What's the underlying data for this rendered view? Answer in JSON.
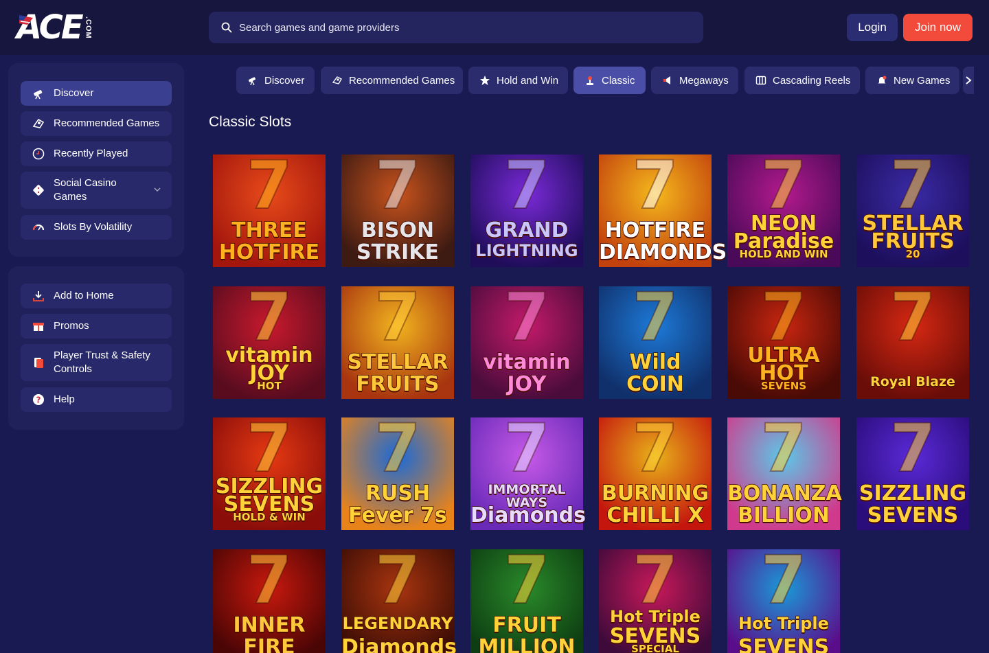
{
  "header": {
    "logo_text": "ACE",
    "logo_suffix": ".COM",
    "search_placeholder": "Search games and game providers",
    "login_label": "Login",
    "join_label": "Join now"
  },
  "sidebar": {
    "primary": [
      {
        "label": "Discover",
        "icon": "telescope-icon",
        "active": true
      },
      {
        "label": "Recommended Games",
        "icon": "recommended-icon"
      },
      {
        "label": "Recently Played",
        "icon": "clock-icon"
      },
      {
        "label": "Social Casino Games",
        "icon": "dice-icon",
        "expandable": true
      },
      {
        "label": "Slots By Volatility",
        "icon": "gauge-icon"
      }
    ],
    "secondary": [
      {
        "label": "Add to Home",
        "icon": "download-icon"
      },
      {
        "label": "Promos",
        "icon": "gift-icon"
      },
      {
        "label": "Player Trust & Safety Controls",
        "icon": "cards-icon"
      },
      {
        "label": "Help",
        "icon": "help-icon"
      }
    ]
  },
  "tabs": [
    {
      "label": "Discover",
      "icon": "telescope-icon"
    },
    {
      "label": "Recommended Games",
      "icon": "recommended-icon"
    },
    {
      "label": "Hold and Win",
      "icon": "star-icon"
    },
    {
      "label": "Classic",
      "icon": "joystick-icon",
      "active": true
    },
    {
      "label": "Megaways",
      "icon": "megaphone-icon"
    },
    {
      "label": "Cascading Reels",
      "icon": "reels-icon"
    },
    {
      "label": "New Games",
      "icon": "bell-icon"
    }
  ],
  "section_title": "Classic Slots",
  "games": [
    {
      "title_lines": [
        "THREE",
        "HOTFIRE"
      ],
      "bg": [
        "#e84b1a",
        "#a3160d"
      ],
      "text": "#ffb21f"
    },
    {
      "title_lines": [
        "BISON",
        "STRIKE"
      ],
      "bg": [
        "#c8531d",
        "#3d1a12"
      ],
      "text": "#e6e6ea"
    },
    {
      "title_lines": [
        "GRAND",
        "LIGHTNING"
      ],
      "bg": [
        "#7a2ad8",
        "#1f0d5a"
      ],
      "text": "#c9c5ff"
    },
    {
      "title_lines": [
        "HOTFIRE",
        "DIAMONDS"
      ],
      "bg": [
        "#f5b91d",
        "#c2410c"
      ],
      "text": "#ffffff"
    },
    {
      "title_lines": [
        "NEON",
        "Paradise",
        "HOLD AND WIN"
      ],
      "bg": [
        "#b31a8c",
        "#4a0a59"
      ],
      "text": "#ffd23a"
    },
    {
      "title_lines": [
        "STELLAR",
        "FRUITS",
        "20"
      ],
      "bg": [
        "#3a2aa6",
        "#1d0f5c"
      ],
      "text": "#ffc83a"
    },
    {
      "title_lines": [
        "vitamin",
        "JOY",
        "HOT"
      ],
      "bg": [
        "#c9192d",
        "#5a0c1f"
      ],
      "text": "#ffd23a"
    },
    {
      "title_lines": [
        "STELLAR",
        "FRUITS"
      ],
      "bg": [
        "#f2b41f",
        "#a8350f"
      ],
      "text": "#ffc83a"
    },
    {
      "title_lines": [
        "vitamin",
        "JOY"
      ],
      "bg": [
        "#c41a6a",
        "#4b0c3c"
      ],
      "text": "#ff8ad8"
    },
    {
      "title_lines": [
        "Wild",
        "COIN"
      ],
      "bg": [
        "#1d7ad8",
        "#10306b"
      ],
      "text": "#ffd23a"
    },
    {
      "title_lines": [
        "ULTRA",
        "HOT",
        "SEVENS"
      ],
      "bg": [
        "#c8260f",
        "#4a0a06"
      ],
      "text": "#ffb21f"
    },
    {
      "title_lines": [
        "Royal Blaze"
      ],
      "bg": [
        "#d62812",
        "#6a0d08"
      ],
      "text": "#ffd23a"
    },
    {
      "title_lines": [
        "SIZZLING",
        "SEVENS",
        "HOLD & WIN"
      ],
      "bg": [
        "#e63a12",
        "#8a0d0a"
      ],
      "text": "#ffd23a"
    },
    {
      "title_lines": [
        "RUSH",
        "Fever 7s"
      ],
      "bg": [
        "#1a6ad8",
        "#e8831a"
      ],
      "text": "#ffd23a"
    },
    {
      "title_lines": [
        "IMMORTAL WAYS",
        "Diamonds"
      ],
      "bg": [
        "#c75ae8",
        "#6a2ab8"
      ],
      "text": "#e7dcff"
    },
    {
      "title_lines": [
        "BURNING",
        "CHILLI X"
      ],
      "bg": [
        "#e8b21a",
        "#c4160d"
      ],
      "text": "#ffd23a"
    },
    {
      "title_lines": [
        "BONANZA",
        "BILLION"
      ],
      "bg": [
        "#5bc8e8",
        "#d03a8c"
      ],
      "text": "#ffd23a"
    },
    {
      "title_lines": [
        "SIZZLING",
        "SEVENS"
      ],
      "bg": [
        "#5a2ad8",
        "#2a0c7a"
      ],
      "text": "#ffd23a"
    },
    {
      "title_lines": [
        "INNER",
        "FIRE"
      ],
      "bg": [
        "#c8190d",
        "#4a0505"
      ],
      "text": "#ffc83a"
    },
    {
      "title_lines": [
        "LEGENDARY",
        "Diamonds"
      ],
      "bg": [
        "#a8350f",
        "#3d0d05"
      ],
      "text": "#ffd23a"
    },
    {
      "title_lines": [
        "FRUIT",
        "MILLION"
      ],
      "bg": [
        "#2a8a2a",
        "#0d3d12"
      ],
      "text": "#ffd23a"
    },
    {
      "title_lines": [
        "Hot Triple",
        "SEVENS",
        "SPECIAL"
      ],
      "bg": [
        "#c8195a",
        "#3d0a3a"
      ],
      "text": "#ffd23a"
    },
    {
      "title_lines": [
        "Hot Triple",
        "SEVENS"
      ],
      "bg": [
        "#1a9ad8",
        "#5a0d8a"
      ],
      "text": "#ffd23a"
    }
  ]
}
